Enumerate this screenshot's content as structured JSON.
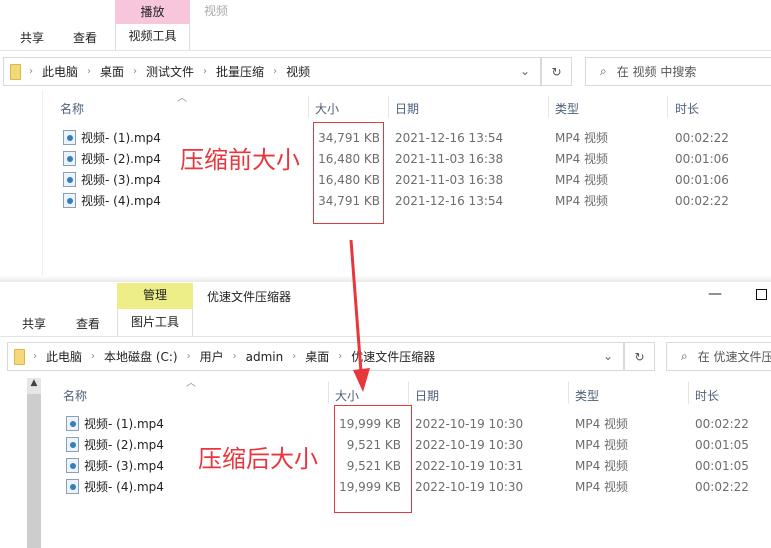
{
  "before": {
    "ribbon": {
      "context_tab": "播放",
      "title": "视频",
      "tabs": [
        "共享",
        "查看",
        "视频工具"
      ]
    },
    "breadcrumb": [
      "此电脑",
      "桌面",
      "测试文件",
      "批量压缩",
      "视频"
    ],
    "search_placeholder": "在 视频 中搜索",
    "columns": [
      "名称",
      "大小",
      "日期",
      "类型",
      "时长"
    ],
    "files": [
      {
        "name": "视频- (1).mp4",
        "size": "34,791 KB",
        "date": "2021-12-16 13:54",
        "type": "MP4 视频",
        "duration": "00:02:22"
      },
      {
        "name": "视频- (2).mp4",
        "size": "16,480 KB",
        "date": "2021-11-03 16:38",
        "type": "MP4 视频",
        "duration": "00:01:06"
      },
      {
        "name": "视频- (3).mp4",
        "size": "16,480 KB",
        "date": "2021-11-03 16:38",
        "type": "MP4 视频",
        "duration": "00:01:06"
      },
      {
        "name": "视频- (4).mp4",
        "size": "34,791 KB",
        "date": "2021-12-16 13:54",
        "type": "MP4 视频",
        "duration": "00:02:22"
      }
    ],
    "annotation": "压缩前大小"
  },
  "after": {
    "ribbon": {
      "context_tab": "管理",
      "title": "优速文件压缩器",
      "tabs": [
        "共享",
        "查看",
        "图片工具"
      ]
    },
    "breadcrumb": [
      "此电脑",
      "本地磁盘 (C:)",
      "用户",
      "admin",
      "桌面",
      "优速文件压缩器"
    ],
    "search_placeholder": "在 优速文件压缩器 中搜索",
    "columns": [
      "名称",
      "大小",
      "日期",
      "类型",
      "时长"
    ],
    "files": [
      {
        "name": "视频- (1).mp4",
        "size": "19,999 KB",
        "date": "2022-10-19 10:30",
        "type": "MP4 视频",
        "duration": "00:02:22"
      },
      {
        "name": "视频- (2).mp4",
        "size": "9,521 KB",
        "date": "2022-10-19 10:30",
        "type": "MP4 视频",
        "duration": "00:01:05"
      },
      {
        "name": "视频- (3).mp4",
        "size": "9,521 KB",
        "date": "2022-10-19 10:31",
        "type": "MP4 视频",
        "duration": "00:01:05"
      },
      {
        "name": "视频- (4).mp4",
        "size": "19,999 KB",
        "date": "2022-10-19 10:30",
        "type": "MP4 视频",
        "duration": "00:02:22"
      }
    ],
    "annotation": "压缩后大小"
  },
  "colors": {
    "annotation": "#e8363d",
    "play_tab": "#f7c5dc",
    "manage_tab": "#eeee88"
  }
}
